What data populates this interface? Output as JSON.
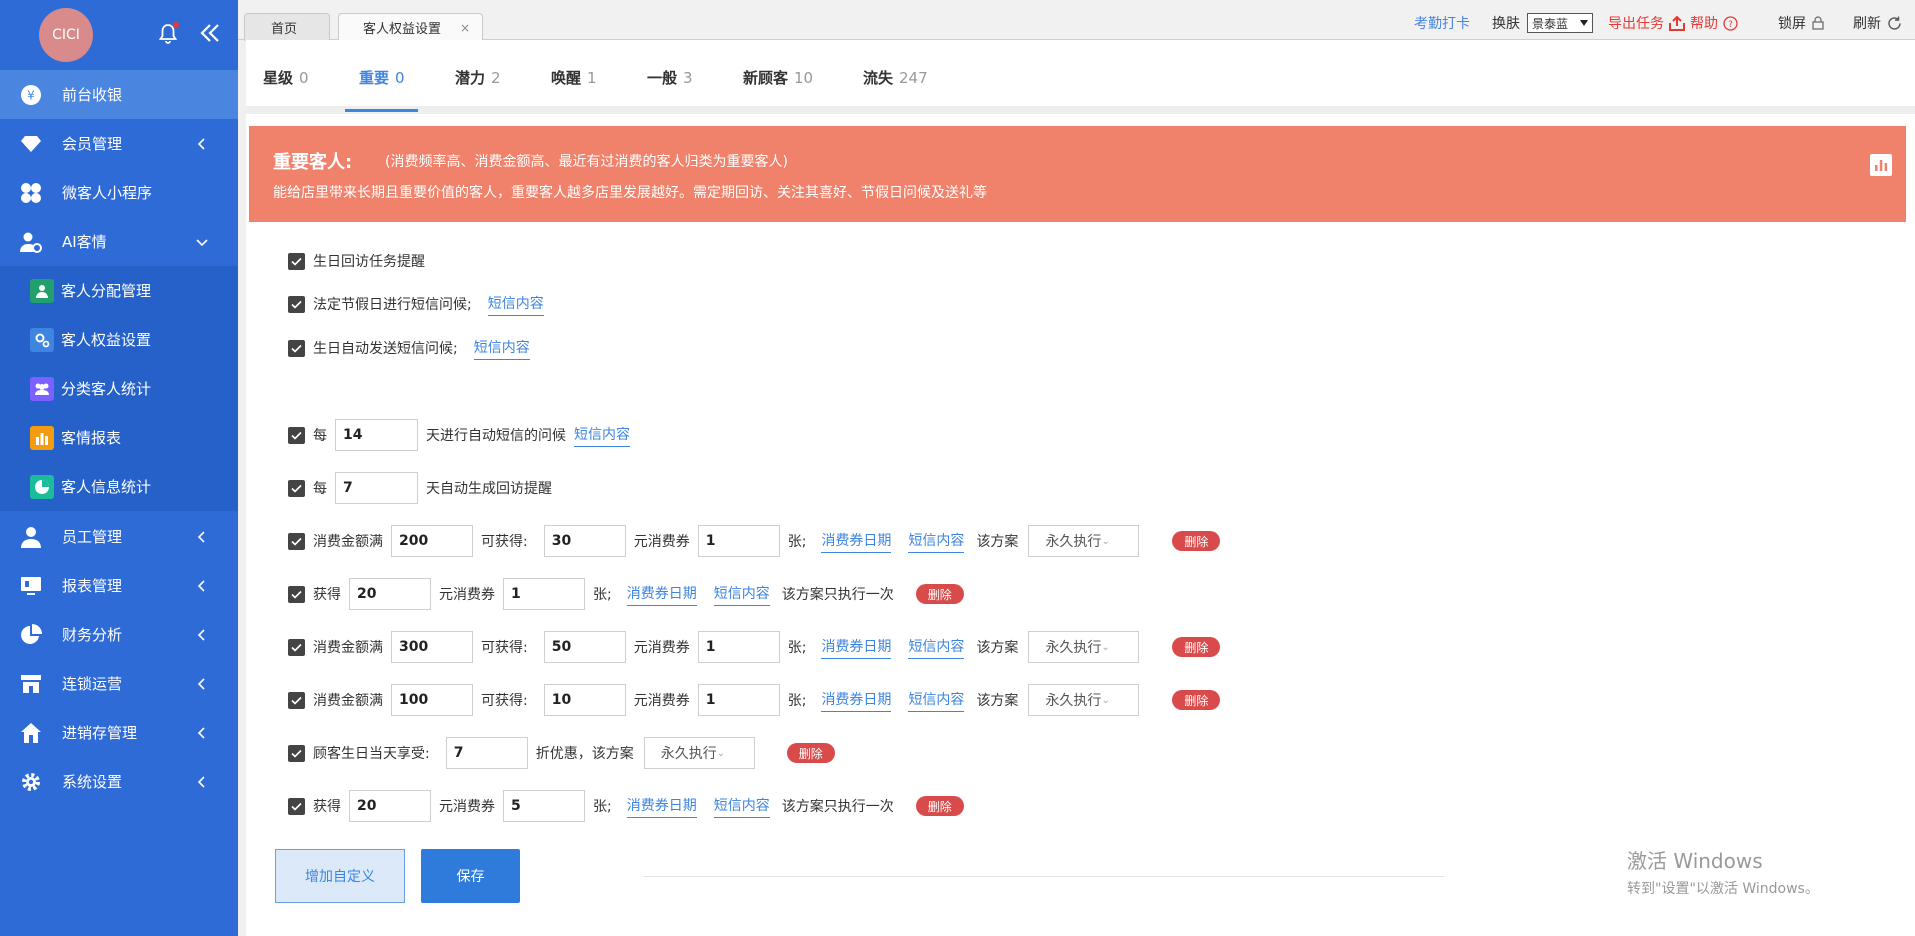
{
  "sidebar": {
    "avatar_text": "CICI",
    "items": [
      {
        "label": "前台收银"
      },
      {
        "label": "会员管理"
      },
      {
        "label": "微客人小程序"
      },
      {
        "label": "AI客情"
      },
      {
        "label": "员工管理"
      },
      {
        "label": "报表管理"
      },
      {
        "label": "财务分析"
      },
      {
        "label": "连锁运营"
      },
      {
        "label": "进销存管理"
      },
      {
        "label": "系统设置"
      }
    ],
    "sub_items": [
      {
        "label": "客人分配管理",
        "color": "#22a06b"
      },
      {
        "label": "客人权益设置",
        "color": "#3d85e0"
      },
      {
        "label": "分类客人统计",
        "color": "#7b61ff"
      },
      {
        "label": "客情报表",
        "color": "#f39c12"
      },
      {
        "label": "客人信息统计",
        "color": "#1abc9c"
      }
    ]
  },
  "topbar": {
    "tabs": [
      {
        "label": "首页"
      },
      {
        "label": "客人权益设置",
        "close": "×"
      }
    ],
    "checkin": "考勤打卡",
    "skin_label": "换肤",
    "skin_value": "景泰蓝",
    "export": "导出任务",
    "help": "帮助",
    "lock": "锁屏",
    "refresh": "刷新"
  },
  "subtabs": [
    {
      "label": "星级",
      "count": "0"
    },
    {
      "label": "重要",
      "count": "0"
    },
    {
      "label": "潜力",
      "count": "2"
    },
    {
      "label": "唤醒",
      "count": "1"
    },
    {
      "label": "一般",
      "count": "3"
    },
    {
      "label": "新顾客",
      "count": "10"
    },
    {
      "label": "流失",
      "count": "247"
    }
  ],
  "banner": {
    "title": "重要客人:",
    "subtitle": "(消费频率高、消费金额高、最近有过消费的客人归类为重要客人)",
    "desc": "能给店里带来长期且重要价值的客人，重要客人越多店里发展越好。需定期回访、关注其喜好、节假日问候及送礼等"
  },
  "rules": {
    "r1": "生日回访任务提醒",
    "r2": "法定节假日进行短信问候;",
    "r3": "生日自动发送短信问候;",
    "sms": "短信内容",
    "coupon_date": "消费券日期",
    "every": "每",
    "r4_val": "14",
    "r4_text": "天进行自动短信的问候",
    "r5_val": "7",
    "r5_text": "天自动生成回访提醒",
    "spend_full": "消费金额满",
    "can_get": "可获得:",
    "yuan_coupon": "元消费券",
    "zhang": "张;",
    "plan_label": "该方案",
    "plan_value": "永久执行",
    "once": "该方案只执行一次",
    "get": "获得",
    "delete": "删除",
    "birthday_discount": "顾客生日当天享受:",
    "discount_text": "折优惠，该方案",
    "c1": {
      "spend": "200",
      "amount": "30",
      "count": "1"
    },
    "c2": {
      "amount": "20",
      "count": "1"
    },
    "c3": {
      "spend": "300",
      "amount": "50",
      "count": "1"
    },
    "c4": {
      "spend": "100",
      "amount": "10",
      "count": "1"
    },
    "c5": {
      "discount": "7"
    },
    "c6": {
      "amount": "20",
      "count": "5"
    }
  },
  "buttons": {
    "add_custom": "增加自定义",
    "save": "保存"
  },
  "watermark": {
    "line1": "激活 Windows",
    "line2": "转到\"设置\"以激活 Windows。"
  }
}
